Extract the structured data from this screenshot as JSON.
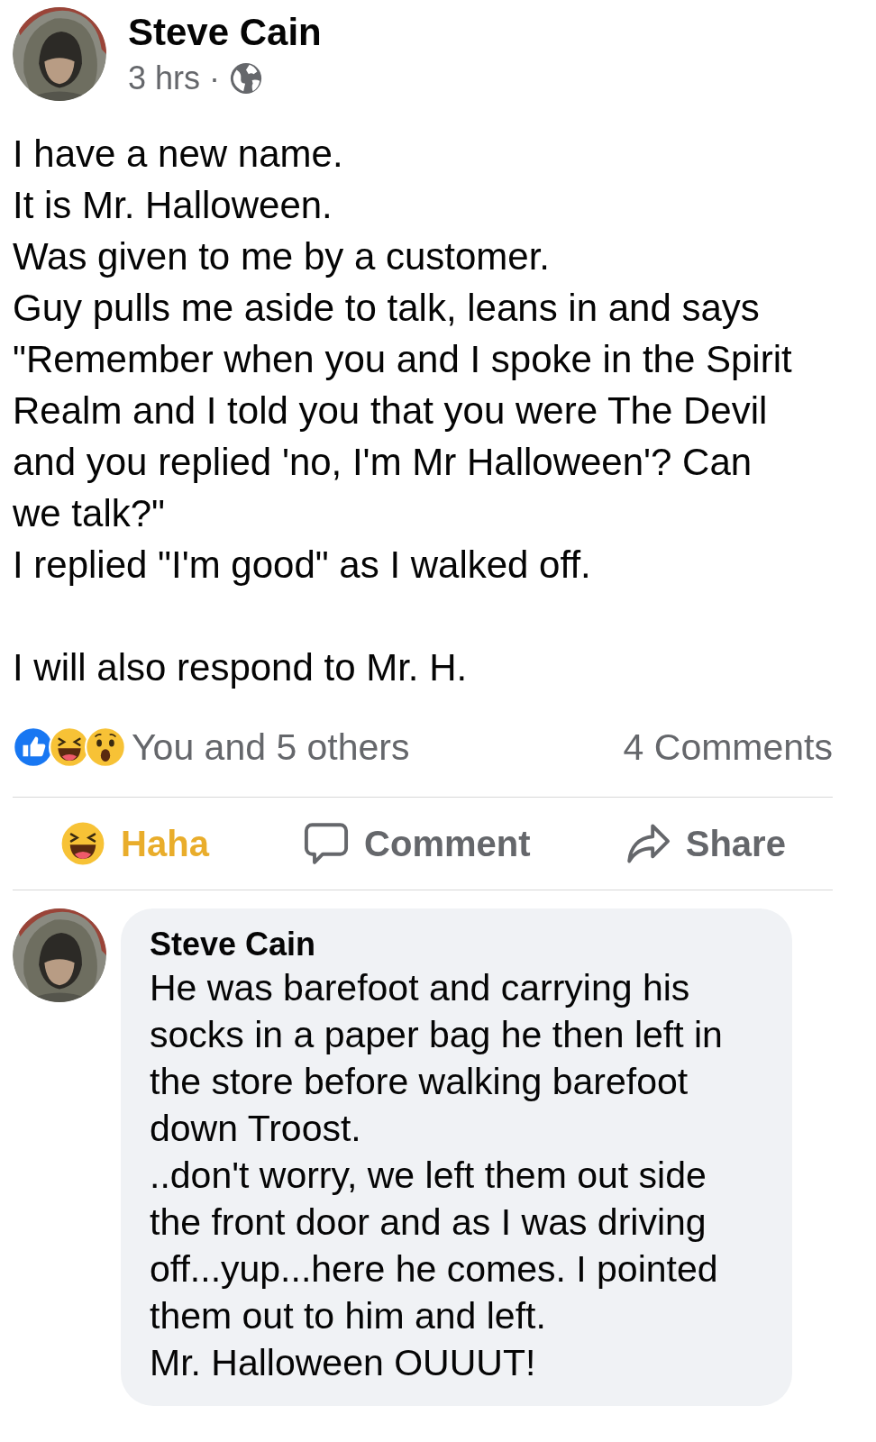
{
  "post": {
    "author": "Steve Cain",
    "time": "3 hrs",
    "separator": "·",
    "paragraphs": [
      [
        "I have a new name.",
        "It is Mr. Halloween.",
        "Was given to me by a customer.",
        "Guy pulls me aside to talk, leans in and says",
        "\"Remember when you and I spoke in the Spirit",
        "Realm and I told you that you were The Devil",
        "and you replied 'no, I'm Mr Halloween'? Can",
        "we talk?\"",
        "I replied \"I'm good\" as I walked off."
      ],
      [
        "I will also respond to Mr. H."
      ]
    ],
    "reactions": [
      {
        "kind": "like"
      },
      {
        "kind": "haha"
      },
      {
        "kind": "wow"
      }
    ],
    "reaction_summary": "You and 5 others",
    "comment_count": "4 Comments",
    "actions": [
      {
        "kind": "haha",
        "label": "Haha",
        "active": true
      },
      {
        "kind": "comment",
        "label": "Comment",
        "active": false
      },
      {
        "kind": "share",
        "label": "Share",
        "active": false
      }
    ]
  },
  "comment": {
    "author": "Steve Cain",
    "lines": [
      "He was barefoot and carrying his",
      "socks in a paper bag he then left in",
      "the store before walking barefoot",
      "down Troost.",
      "..don't worry, we left them out side",
      "the front door and as I was driving",
      "off...yup...here he comes. I pointed",
      "them out to him and left.",
      "Mr. Halloween OUUUT!"
    ]
  }
}
